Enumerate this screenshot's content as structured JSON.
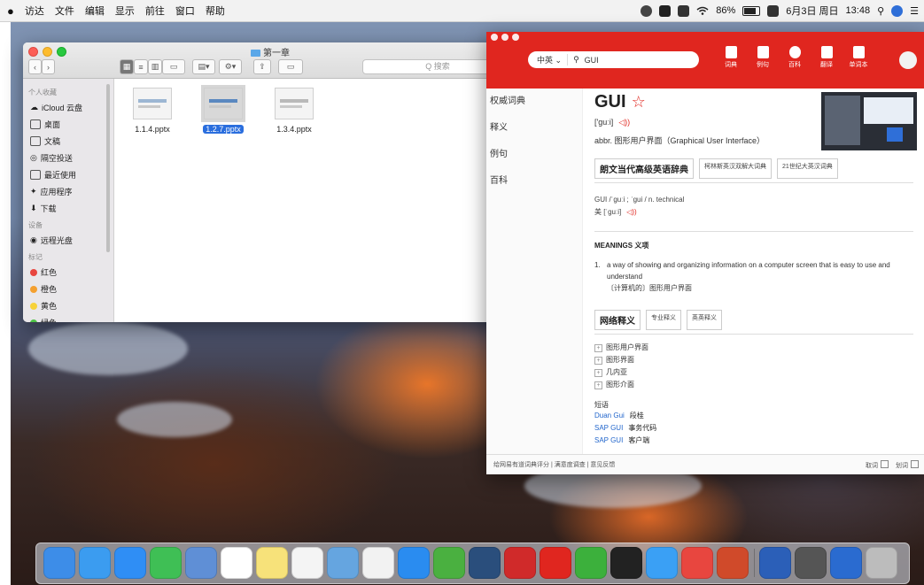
{
  "menubar": {
    "apple": "",
    "items": [
      "访达",
      "文件",
      "编辑",
      "显示",
      "前往",
      "窗口",
      "帮助"
    ],
    "battery": "86%",
    "date": "6月3日 周日",
    "time": "13:48"
  },
  "finder": {
    "title": "第一章",
    "search_placeholder": "Q 搜索",
    "sidebar": {
      "section_favorites": "个人收藏",
      "favorites": [
        "iCloud 云盘",
        "桌面",
        "文稿",
        "隔空投送",
        "最近使用",
        "应用程序",
        "下载"
      ],
      "section_devices": "设备",
      "devices": [
        "远程光盘"
      ],
      "section_tags": "标记",
      "tags": [
        {
          "label": "红色",
          "color": "#e8463f"
        },
        {
          "label": "橙色",
          "color": "#f4a030"
        },
        {
          "label": "黄色",
          "color": "#f7d23a"
        },
        {
          "label": "绿色",
          "color": "#4cc245"
        }
      ]
    },
    "files": [
      {
        "name": "1.1.4.pptx",
        "selected": false
      },
      {
        "name": "1.2.7.pptx",
        "selected": true
      },
      {
        "name": "1.3.4.pptx",
        "selected": false
      }
    ]
  },
  "dict": {
    "lang_select": "中英",
    "query": "GUI",
    "header_tabs": [
      "词典",
      "例句",
      "百科",
      "翻译",
      "单词本"
    ],
    "left_nav": [
      "权威词典",
      "释义",
      "例句",
      "百科"
    ],
    "word": "GUI",
    "star": "☆",
    "phonetic": "['guːi]",
    "speaker": "◁))",
    "abbr": "abbr. 图形用户界面（Graphical User Interface）",
    "dict_tabs": [
      "朗文当代高级英语辞典",
      "柯林斯英汉双解大词典",
      "21世纪大英汉词典"
    ],
    "entry_line1": "GUI /ˈguːi ; ˈgui /   n.   technical",
    "entry_line2": "美  [ˈguːi]",
    "meanings_title": "MEANINGS 义项",
    "meaning_num": "1.",
    "meaning_en": "a way of showing and organizing information on a computer screen that is easy to use and understand",
    "meaning_cn": "〔计算机的〕图形用户界面",
    "web_tabs": [
      "网络释义",
      "专业释义",
      "英英释义"
    ],
    "web_items": [
      "图形用户界面",
      "图形界面",
      "几内亚",
      "图形介面"
    ],
    "phrase_title": "短语",
    "phrases": [
      {
        "en": "Duan Gui",
        "cn": "段桂"
      },
      {
        "en": "SAP GUI",
        "cn": "事务代码"
      },
      {
        "en": "SAP GUI",
        "cn": "客户端"
      }
    ],
    "footer_left": "给网易有道词典评分 | 满意度调查 | 意见反馈",
    "footer_right_1": "取词",
    "footer_right_2": "划词"
  },
  "dock": {
    "colors": [
      "#3d8de8",
      "#3b9cf0",
      "#2f8ef5",
      "#3fbf55",
      "#5f8fd6",
      "#ffffff",
      "#f7e27a",
      "#f4f4f4",
      "#65a5e0",
      "#f2f2f2",
      "#2a8cf0",
      "#4ab040",
      "#2a4e7c",
      "#d02a2a",
      "#e0261f",
      "#3cb03c",
      "#222222",
      "#3aa0f5",
      "#e8463f",
      "#d04a2a",
      "#2b5fb8",
      "#555555",
      "#2a6bd0",
      "#bcbcbc"
    ]
  }
}
